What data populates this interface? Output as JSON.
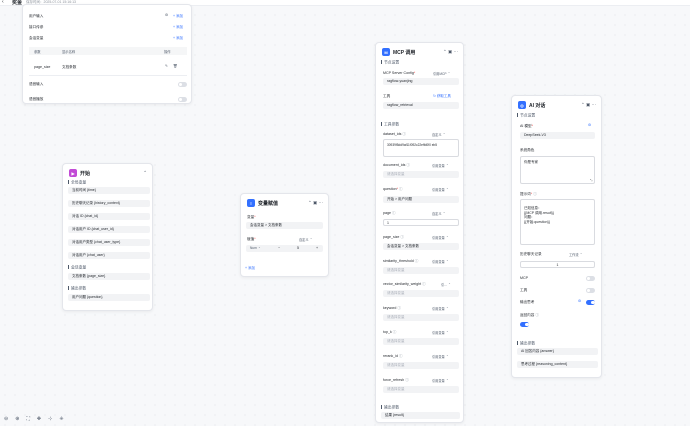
{
  "header": {
    "back": "‹",
    "title": "奖金",
    "subtitle": "保存时间：2025-07-01 15:16:13"
  },
  "settings": {
    "user_input": "用户输入",
    "interface_params": "接口传参",
    "session_vars": "会话变量",
    "add": "添加",
    "table_headers": [
      "参数",
      "显示名称",
      "操作"
    ],
    "row_param": "page_size",
    "row_display": "文档条数",
    "voice_input": "语音输入",
    "voice_play": "语音播放"
  },
  "start": {
    "title": "开始",
    "sections": [
      "全局变量",
      "会话变量",
      "输出参数"
    ],
    "global_vars": [
      "当前时间 {time}",
      "历史聊天记录 {history_context}",
      "对话 ID {chat_id}",
      "对话用户 ID {chat_user_id}",
      "对话用户类型 {chat_user_type}",
      "对话用户 {chat_user}"
    ],
    "session_vars": [
      "文档条数 {page_size}"
    ],
    "outputs": [
      "用户问题 {question}"
    ]
  },
  "assign": {
    "title": "变量赋值",
    "variable_label": "变量",
    "variable_value": "会话变量 > 文档条数",
    "assign_label": "赋值",
    "custom": "自定义",
    "number_type": "Num",
    "value": "5",
    "add": "添加"
  },
  "mcp": {
    "title": "MCP 调用",
    "node_settings": "节点设置",
    "server_config_label": "MCP Server Config",
    "reference": "引用MCP",
    "server_value": "ragflow-yuanjing",
    "tool_label": "工具",
    "refresh": "获取工具",
    "tool_value": "ragflow_retrieval",
    "tool_params": "工具参数",
    "custom": "自定义",
    "ref_var": "引用变量",
    "choose_var": "请选择变量",
    "params": [
      {
        "name": "dataset_ids",
        "mode": "自定义",
        "value": "30939f5dd9af11f092c22effd0f0 eb5"
      },
      {
        "name": "document_ids",
        "mode": "引用变量",
        "value": "请选择变量"
      },
      {
        "name": "question",
        "mode": "引用变量",
        "value": "开始 > 用户问题"
      },
      {
        "name": "page",
        "mode": "自定义",
        "value": "1"
      },
      {
        "name": "page_size",
        "mode": "引用变量",
        "value": "会话变量 > 文档条数"
      },
      {
        "name": "similarity_threshold",
        "mode": "引用变量",
        "value": "请选择变量"
      },
      {
        "name": "vector_similarity_weight",
        "mode": "引...",
        "value": "请选择变量"
      },
      {
        "name": "keyword",
        "mode": "引用变量",
        "value": "请选择变量"
      },
      {
        "name": "top_k",
        "mode": "引用变量",
        "value": "请选择变量"
      },
      {
        "name": "rerank_id",
        "mode": "引用变量",
        "value": "请选择变量"
      },
      {
        "name": "force_refresh",
        "mode": "引用变量",
        "value": "请选择变量"
      }
    ],
    "output_section": "输出参数",
    "output": "结果 {result}"
  },
  "ai": {
    "title": "AI 对话",
    "node_settings": "节点设置",
    "model_label": "AI 模型",
    "model_value": "DeepSeek-V3",
    "role_label": "系统角色",
    "role_value": "你是专家",
    "prompt_label": "提示词",
    "prompt_value": "已知信息：\n{{MCP 调用.result}}\n问题：\n{{开始.question}}",
    "history_label": "历史聊天记录",
    "history_mode": "工作流",
    "history_value": "1",
    "mcp_label": "MCP",
    "tools_label": "工具",
    "think_label": "输出思考",
    "return_label": "返回内容",
    "output_section": "输出参数",
    "outputs": [
      "AI 回答内容 {answer}",
      "思考过程 {reasoning_content}"
    ]
  },
  "colors": {
    "accent": "#3370ff",
    "start_icon": "#c24bd6",
    "assign_icon": "#3370ff",
    "mcp_icon": "#3370ff",
    "ai_icon": "#3370ff"
  }
}
